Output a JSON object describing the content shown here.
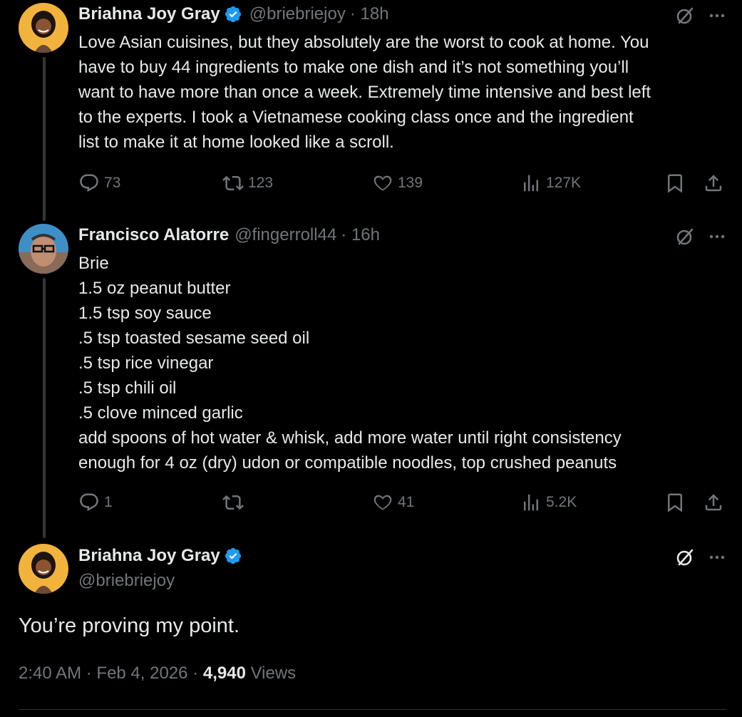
{
  "tweet1": {
    "name": "Briahna Joy Gray",
    "handle": "@briebriejoy",
    "time": "· 18h",
    "lines": [
      "Love Asian cuisines, but they absolutely are the worst to cook at home. You",
      "have to buy 44 ingredients to make one dish and it’s not something you’ll",
      "want to have more than once a week. Extremely time intensive and best left",
      "to the experts. I took a Vietnamese cooking class once and the ingredient",
      "list to make it at home looked like a scroll."
    ],
    "replies": "73",
    "reposts": "123",
    "likes": "139",
    "views": "127K"
  },
  "tweet2": {
    "name": "Francisco Alatorre",
    "handle": "@fingerroll44",
    "time": "· 16h",
    "lines": [
      "Brie",
      "1.5 oz peanut butter",
      "1.5 tsp soy sauce",
      ".5 tsp toasted sesame seed oil",
      ".5 tsp rice vinegar",
      ".5 tsp chili oil",
      ".5 clove minced garlic",
      "add spoons of hot water & whisk, add more water until right consistency",
      "enough for 4 oz (dry) udon or compatible noodles, top crushed peanuts"
    ],
    "replies": "1",
    "reposts": "",
    "likes": "41",
    "views": "5.2K"
  },
  "tweet3": {
    "name": "Briahna Joy Gray",
    "handle": "@briebriejoy",
    "text": "You’re proving my point.",
    "time": "2:40 AM",
    "date": "Feb 4, 2026",
    "views_count": "4,940",
    "views_label": "Views"
  },
  "colors": {
    "background": "#000000",
    "text": "#e7e9ea",
    "muted": "#71767b",
    "verified": "#1d9bf0",
    "thread_line": "#333639"
  },
  "icons": [
    "verified-badge-icon",
    "grok-icon",
    "more-icon",
    "reply-icon",
    "repost-icon",
    "like-icon",
    "views-icon",
    "bookmark-icon",
    "share-icon"
  ]
}
